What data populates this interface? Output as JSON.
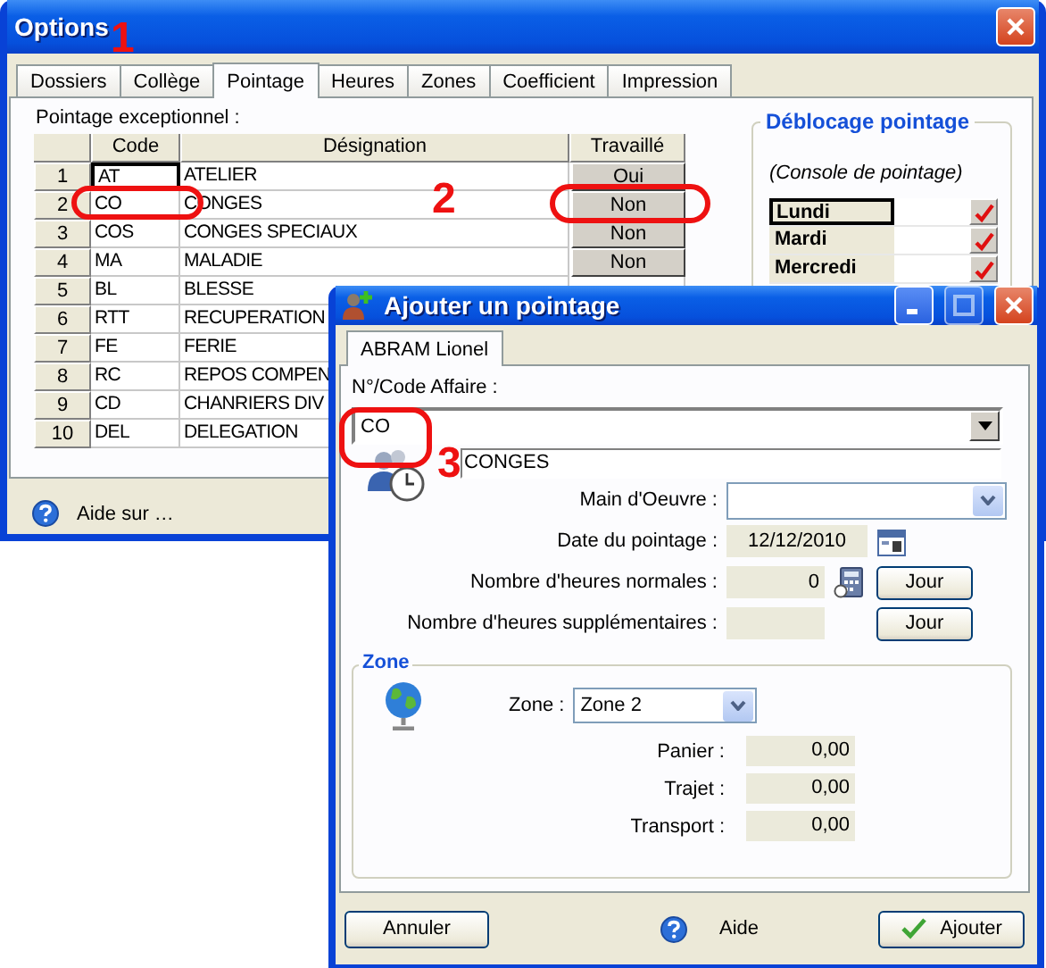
{
  "options_window": {
    "title": "Options",
    "tabs": [
      {
        "label": "Dossiers",
        "selected": false
      },
      {
        "label": "Collège",
        "selected": false
      },
      {
        "label": "Pointage",
        "selected": true
      },
      {
        "label": "Heures",
        "selected": false
      },
      {
        "label": "Zones",
        "selected": false
      },
      {
        "label": "Coefficient",
        "selected": false
      },
      {
        "label": "Impression",
        "selected": false
      }
    ],
    "section_label": "Pointage exceptionnel :",
    "table": {
      "columns": [
        "Code",
        "Désignation",
        "Travaillé"
      ],
      "rows": [
        {
          "number": "1",
          "code": "AT",
          "designation": "ATELIER",
          "travaille": "Oui",
          "selected": true
        },
        {
          "number": "2",
          "code": "CO",
          "designation": "CONGES",
          "travaille": "Non",
          "selected": false
        },
        {
          "number": "3",
          "code": "COS",
          "designation": "CONGES SPECIAUX",
          "travaille": "Non",
          "selected": false
        },
        {
          "number": "4",
          "code": "MA",
          "designation": "MALADIE",
          "travaille": "Non",
          "selected": false
        },
        {
          "number": "5",
          "code": "BL",
          "designation": "BLESSE",
          "selected": false
        },
        {
          "number": "6",
          "code": "RTT",
          "designation": "RECUPERATION",
          "selected": false
        },
        {
          "number": "7",
          "code": "FE",
          "designation": "FERIE",
          "selected": false
        },
        {
          "number": "8",
          "code": "RC",
          "designation": "REPOS COMPEN",
          "selected": false
        },
        {
          "number": "9",
          "code": "CD",
          "designation": "CHANRIERS DIV",
          "selected": false
        },
        {
          "number": "10",
          "code": "DEL",
          "designation": "DELEGATION",
          "selected": false
        }
      ]
    },
    "unlock_group": {
      "title": "Déblocage pointage",
      "subtitle": "(Console de pointage)",
      "days": [
        {
          "label": "Lundi",
          "selected": true,
          "checked": true
        },
        {
          "label": "Mardi",
          "selected": false,
          "checked": true
        },
        {
          "label": "Mercredi",
          "selected": false,
          "checked": true
        }
      ]
    },
    "help_link": "Aide sur …"
  },
  "dialog": {
    "title": "Ajouter un pointage",
    "tabs": [
      {
        "label": "ABRAM Lionel",
        "selected": true
      }
    ],
    "affaire_label": "N°/Code Affaire :",
    "affaire_value": "CO",
    "affaire_name": "CONGES",
    "fields": [
      {
        "kind": "combo",
        "label": "Main d'Oeuvre :"
      },
      {
        "kind": "date",
        "label": "Date du pointage :",
        "value": "12/12/2010"
      },
      {
        "kind": "hours_calc",
        "label": "Nombre d'heures normales :",
        "value": "0",
        "button": "Jour"
      },
      {
        "kind": "hours",
        "label": "Nombre d'heures supplémentaires :",
        "button": "Jour"
      }
    ],
    "zone_group": {
      "title": "Zone",
      "zone_label": "Zone :",
      "zone_value": "Zone 2",
      "amounts": [
        {
          "label": "Panier :",
          "value": "0,00"
        },
        {
          "label": "Trajet :",
          "value": "0,00"
        },
        {
          "label": "Transport :",
          "value": "0,00"
        }
      ]
    },
    "cancel_button": "Annuler",
    "help_label": "Aide",
    "add_button": "Ajouter"
  },
  "annotations": [
    {
      "label": "1"
    },
    {
      "label": "2"
    },
    {
      "label": "3"
    }
  ]
}
